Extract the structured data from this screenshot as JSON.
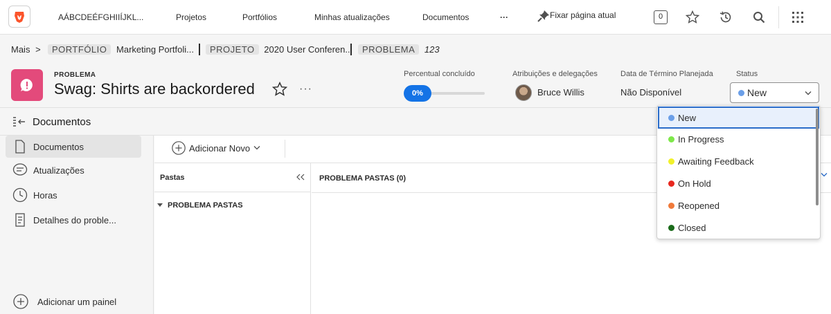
{
  "topnav": {
    "workspace_name": "AÁBCDEÉFGHIIÍJKL...",
    "items": [
      "Projetos",
      "Portfólios",
      "Minhas atualizações",
      "Documentos"
    ],
    "more": "···",
    "pin_label": "Fixar página atual",
    "count": "0"
  },
  "breadcrumb": {
    "mais": "Mais",
    "chevron": ">",
    "portfolio_tag": "PORTFÓLIO",
    "portfolio_name": "Marketing Portfoli...",
    "project_tag": "PROJETO",
    "project_name": "2020 User Conferen...",
    "issue_tag": "PROBLEMA",
    "issue_id": "123"
  },
  "header": {
    "type_label": "PROBLEMA",
    "title": "Swag: Shirts are backordered",
    "more": "···",
    "percent_label": "Percentual concluído",
    "percent_value": "0%",
    "percent_fraction": 0,
    "assign_label": "Atribuições e delegações",
    "assignee": "Bruce Willis",
    "due_label": "Data de Término Planejada",
    "due_value": "Não Disponível",
    "status_label": "Status",
    "status_value": "New",
    "status_color": "#6b9fe8"
  },
  "docbar": {
    "title": "Documentos"
  },
  "sidebar": {
    "items": [
      {
        "label": "Documentos"
      },
      {
        "label": "Atualizações"
      },
      {
        "label": "Horas"
      },
      {
        "label": "Detalhes do proble..."
      }
    ],
    "add_panel": "Adicionar um painel"
  },
  "main": {
    "add_new": "Adicionar Novo",
    "folders_title": "Pastas",
    "folder_group": "PROBLEMA PASTAS",
    "list_title": "PROBLEMA PASTAS (0)"
  },
  "status_options": [
    {
      "label": "New",
      "color": "#6b9fe8"
    },
    {
      "label": "In Progress",
      "color": "#7ee84a"
    },
    {
      "label": "Awaiting Feedback",
      "color": "#f1f12a"
    },
    {
      "label": "On Hold",
      "color": "#e8281f"
    },
    {
      "label": "Reopened",
      "color": "#f07a3a"
    },
    {
      "label": "Closed",
      "color": "#1a6b1a"
    }
  ]
}
